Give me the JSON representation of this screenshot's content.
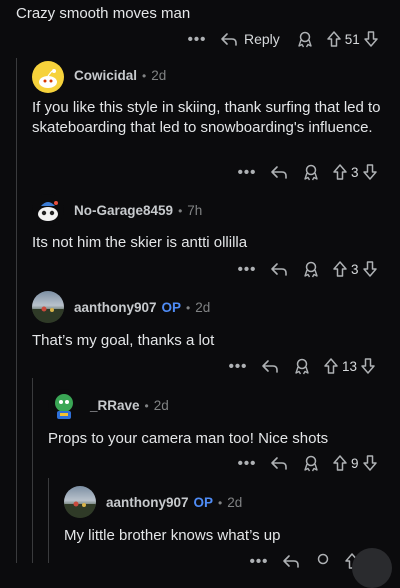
{
  "top_comment": {
    "text": "Crazy smooth moves man",
    "actions": {
      "reply_label": "Reply",
      "score": "51"
    }
  },
  "comments": [
    {
      "username": "Cowicidal",
      "age": "2d",
      "text": "If you like this style in skiing, thank surfing that led to skateboarding that led to snowboarding's influence.",
      "score": "3"
    },
    {
      "username": "No-Garage8459",
      "age": "7h",
      "text": "Its not him the skier is antti ollilla",
      "score": "3"
    },
    {
      "username": "aanthony907",
      "op_badge": "OP",
      "age": "2d",
      "text": "That’s my goal, thanks a lot",
      "score": "13"
    },
    {
      "username": "_RRave",
      "age": "2d",
      "text": "Props to your camera man too! Nice shots",
      "score": "9"
    },
    {
      "username": "aanthony907",
      "op_badge": "OP",
      "age": "2d",
      "text": "My little brother knows what’s up"
    }
  ],
  "colors": {
    "background": "#0b0b0d",
    "op_badge": "#4f8cf6",
    "thread_line": "#3a3b3d"
  }
}
